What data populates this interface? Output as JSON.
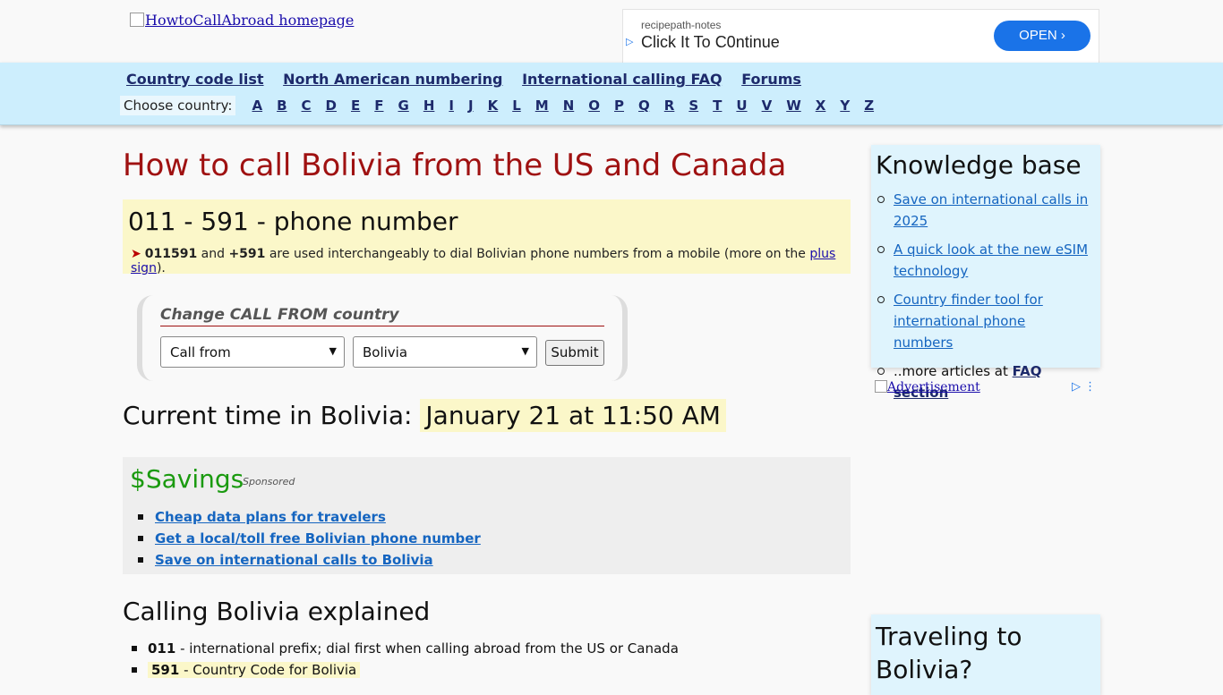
{
  "header": {
    "logo_alt": "HowtoCallAbroad homepage",
    "ad": {
      "brand": "recipepath-notes",
      "text": "Click It To C0ntinue",
      "button": "OPEN"
    }
  },
  "nav": {
    "links": [
      "Country code list",
      "North American numbering",
      "International calling FAQ",
      "Forums"
    ],
    "choose_label": "Choose country:",
    "letters": [
      "A",
      "B",
      "C",
      "D",
      "E",
      "F",
      "G",
      "H",
      "I",
      "J",
      "K",
      "L",
      "M",
      "N",
      "O",
      "P",
      "Q",
      "R",
      "S",
      "T",
      "U",
      "V",
      "W",
      "X",
      "Y",
      "Z"
    ]
  },
  "main": {
    "title": "How to call Bolivia from the US and Canada",
    "dial_format": "011 - 591 - phone number",
    "dial_note": {
      "prefix_a": "011591",
      "and": " and ",
      "prefix_b": "+591",
      "middle": " are used interchangeably to dial Bolivian phone numbers from a mobile (more on the ",
      "link": "plus sign",
      "end": ")."
    },
    "form": {
      "title": "Change CALL FROM country",
      "from_select": "Call from",
      "to_select": "Bolivia",
      "submit": "Submit"
    },
    "time": {
      "label": "Current time in Bolivia:",
      "value": "January 21 at 11:50 AM"
    },
    "savings": {
      "title": "$Savings",
      "sponsored": "Sponsored",
      "links": [
        "Cheap data plans for travelers",
        "Get a local/toll free Bolivian phone number",
        "Save on international calls to Bolivia"
      ]
    },
    "explained": {
      "title": "Calling Bolivia explained",
      "items": [
        {
          "code": "011",
          "text": " - international prefix; dial first when calling abroad from the US or Canada"
        },
        {
          "code": "591",
          "text": " - Country Code for Bolivia"
        }
      ]
    }
  },
  "sidebar": {
    "kb_title": "Knowledge base",
    "kb_links": [
      "Save on international calls in 2025",
      "A quick look at the new eSIM technology",
      "Country finder tool for international phone numbers"
    ],
    "kb_more_prefix": "..more articles at ",
    "kb_more_link": "FAQ section",
    "ad_label": "Advertisement",
    "travel_title": "Traveling to Bolivia?"
  },
  "colors": {
    "nav_bg": "#cdeefd",
    "title_red": "#9f1111",
    "highlight": "#fbf7c9",
    "savings_green": "#1a9a0f",
    "sidebar_bg": "#dff4fd"
  }
}
